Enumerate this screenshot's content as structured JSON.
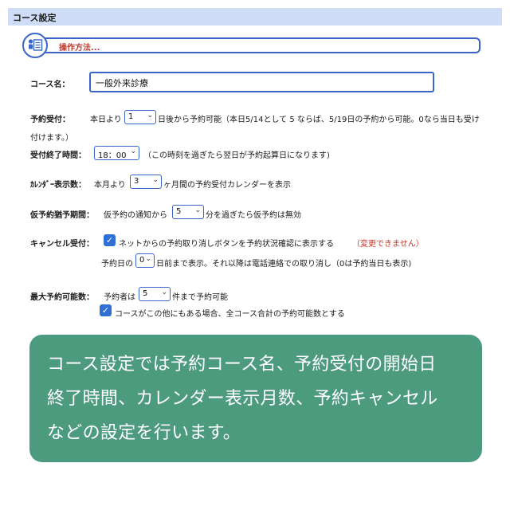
{
  "header": {
    "title": "コース設定"
  },
  "help": {
    "link_text": "操作方法..."
  },
  "course_name": {
    "label": "コース名：",
    "value": "一般外来診療"
  },
  "reservation_start": {
    "label": "予約受付：",
    "prefix": "本日より",
    "value": "1",
    "line1": "日後から予約可能（本日5/14として 5 ならば、5/19日の予約から可能。0なら当日も受け",
    "line2": "付けます。）"
  },
  "reservation_end": {
    "label": "受付終了時間：",
    "value": "18：00",
    "note": "（この時刻を過ぎたら翌日が予約起算日になります)"
  },
  "calendar_months": {
    "label": "ｶﾚﾝﾀﾞｰ表示数：",
    "prefix": "本月より",
    "value": "3",
    "suffix": "ヶ月間の予約受付カレンダーを表示"
  },
  "provisional": {
    "label": "仮予約猶予期間：",
    "prefix": "仮予約の通知から",
    "value": "5",
    "suffix": "分を過ぎたら仮予約は無効"
  },
  "cancel": {
    "label": "キャンセル受付：",
    "checkbox_text": "ネットからの予約取り消しボタンを予約状況確認に表示する",
    "warning": "（変更できません）",
    "prefix": "予約日の",
    "value": "0",
    "suffix": "日前まで表示。それ以降は電話連絡での取り消し（0は予約当日も表示)"
  },
  "max_reservations": {
    "label": "最大予約可能数：",
    "prefix": "予約者は",
    "value": "5",
    "suffix": "件まで予約可能",
    "checkbox_text": "コースがこの他にもある場合、全コース合計の予約可能数とする"
  },
  "overlay": {
    "line1": "コース設定では予約コース名、予約受付の開始日",
    "line2": "終了時間、カレンダー表示月数、予約キャンセル",
    "line3": "などの設定を行います。"
  },
  "colors": {
    "accent": "#3a64c8",
    "header_bg": "#cfdcf5",
    "overlay_bg": "#4d9b7f",
    "warning": "#c0392b"
  }
}
